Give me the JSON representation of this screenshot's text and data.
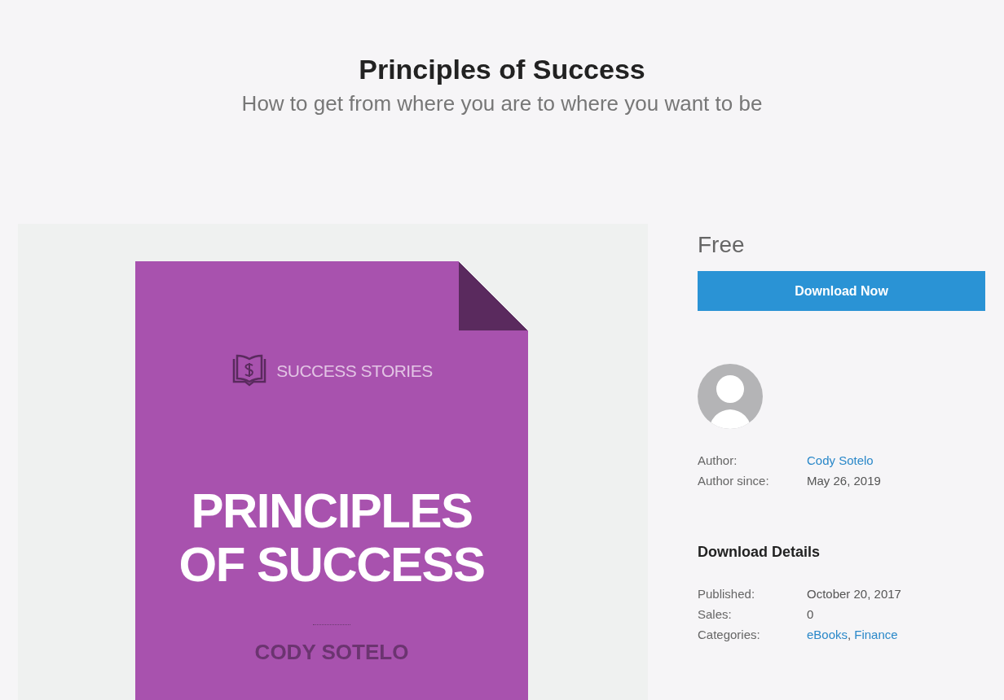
{
  "header": {
    "title": "Principles of Success",
    "subtitle": "How to get from where you are to where you want to be"
  },
  "cover": {
    "brand": "SUCCESS STORIES",
    "title_lines": [
      "PRINCIPLES",
      "OF SUCCESS"
    ],
    "author": "CODY SOTELO"
  },
  "price": "Free",
  "download_button": "Download Now",
  "author_details": [
    {
      "label": "Author:",
      "kind": "links",
      "values": [
        "Cody Sotelo"
      ]
    },
    {
      "label": "Author since:",
      "kind": "text",
      "values": [
        "May 26, 2019"
      ]
    }
  ],
  "download_details": {
    "heading": "Download Details",
    "separator": ",",
    "rows": [
      {
        "label": "Published:",
        "kind": "text",
        "values": [
          "October 20, 2017"
        ]
      },
      {
        "label": "Sales:",
        "kind": "text",
        "values": [
          "0"
        ]
      },
      {
        "label": "Categories:",
        "kind": "links",
        "values": [
          "eBooks",
          "Finance"
        ]
      }
    ]
  }
}
